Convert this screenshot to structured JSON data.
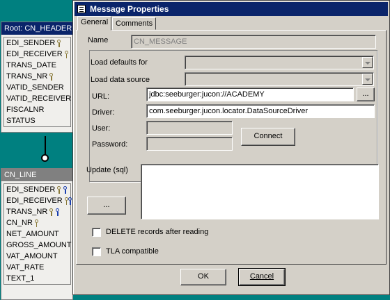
{
  "background": {
    "header_table": {
      "title": "Root: CN_HEADER",
      "rows": [
        "EDI_SENDER",
        "EDI_RECEIVER",
        "TRANS_DATE",
        "TRANS_NR",
        "VATID_SENDER",
        "VATID_RECEIVER",
        "FISCALNR",
        "STATUS"
      ]
    },
    "line_table": {
      "title": "CN_LINE",
      "rows": [
        "EDI_SENDER",
        "EDI_RECEIVER",
        "TRANS_NR",
        "CN_NR",
        "NET_AMOUNT",
        "GROSS_AMOUNT",
        "VAT_AMOUNT",
        "VAT_RATE",
        "TEXT_1"
      ]
    }
  },
  "dialog": {
    "title": "Message Properties",
    "tabs": [
      {
        "label": "General"
      },
      {
        "label": "Comments"
      }
    ],
    "name_label": "Name",
    "name_value": "CN_MESSAGE",
    "load_defaults_label": "Load defaults for",
    "load_datasource_label": "Load data source",
    "url_label": "URL:",
    "url_value": "jdbc:seeburger:jucon://ACADEMY",
    "url_browse_label": "...",
    "driver_label": "Driver:",
    "driver_value": "com.seeburger.jucon.locator.DataSourceDriver",
    "user_label": "User:",
    "password_label": "Password:",
    "connect_label": "Connect",
    "update_label": "Update (sql)",
    "update_browse_label": "...",
    "delete_checkbox_label": "DELETE records after reading",
    "tla_checkbox_label": "TLA compatible",
    "ok_label": "OK",
    "cancel_label": "Cancel"
  },
  "colors": {
    "desktop": "#008080",
    "header_title_bg": "#0a246a",
    "line_title_bg": "#808080",
    "key_gold": "#8a7a3a",
    "key_blue": "#1a3fb0"
  }
}
